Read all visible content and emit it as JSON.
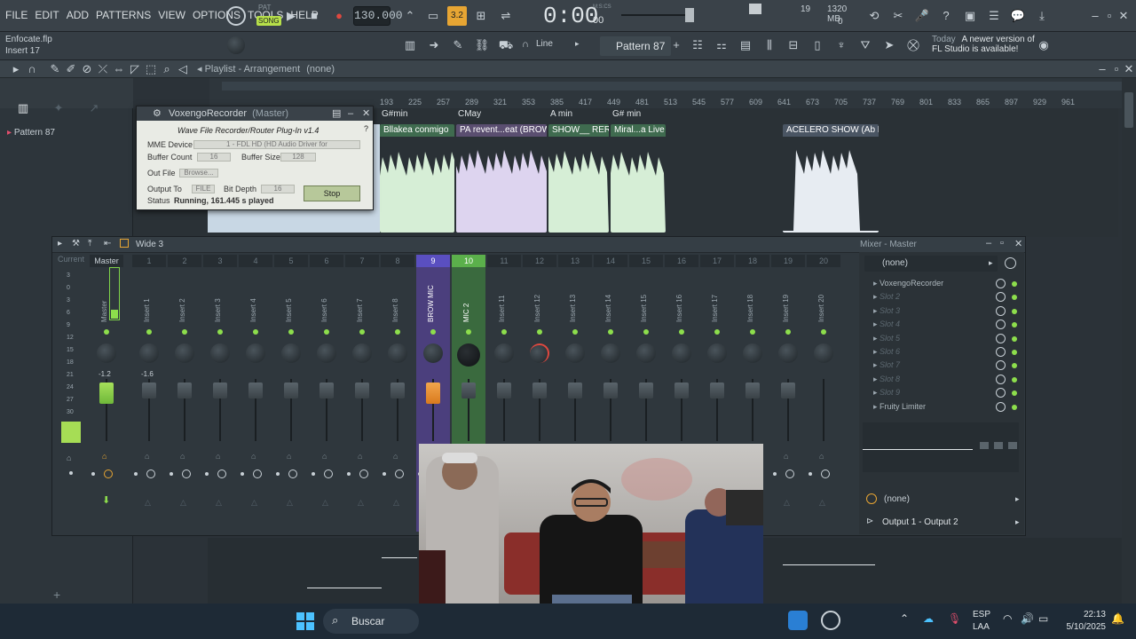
{
  "menu": [
    "FILE",
    "EDIT",
    "ADD",
    "PATTERNS",
    "VIEW",
    "OPTIONS",
    "TOOLS",
    "HELP"
  ],
  "transport": {
    "pat": "PAT",
    "song": "SONG",
    "tempo": "130.000",
    "time": "0:00",
    "time_suffix": "00",
    "time_unit": "M:S:CS",
    "beats": "3.2"
  },
  "cpu": {
    "value": "19",
    "memory": "1320 MB",
    "poly": "0"
  },
  "hint": {
    "file": "Enfocate.flp",
    "insert": "Insert 17"
  },
  "tools": {
    "snap": "Line",
    "pattern": "Pattern 87"
  },
  "news": {
    "label": "Today",
    "line1": "A newer version of",
    "line2": "FL Studio is available!"
  },
  "playlist": {
    "title": "Playlist - Arrangement",
    "sub": "(none)",
    "pattern_item": "Pattern 87"
  },
  "ruler": [
    "193",
    "225",
    "257",
    "289",
    "321",
    "353",
    "385",
    "417",
    "449",
    "481",
    "513",
    "545",
    "577",
    "609",
    "641",
    "673",
    "705",
    "737",
    "769",
    "801",
    "833",
    "865",
    "897",
    "929",
    "961"
  ],
  "markers": [
    {
      "label": "G#min"
    },
    {
      "label": "CMay"
    },
    {
      "label": "A min"
    },
    {
      "label": "G# min"
    }
  ],
  "clips": [
    {
      "label": "Bllakea conmigo",
      "color": "#3f6b4f"
    },
    {
      "label": "PA revent...eat (BROW)",
      "color": "#5a4e70"
    },
    {
      "label": "SHOW__ RERO",
      "color": "#3f6b4f"
    },
    {
      "label": "Miral...a Live",
      "color": "#3f6b4f"
    },
    {
      "label": "ACELERO SHOW (Ab Min)",
      "color": "#4a5563"
    }
  ],
  "plugin": {
    "title": "VoxengoRecorder",
    "title_suffix": "(Master)",
    "heading": "Wave File Recorder/Router Plug-In v1.4",
    "mme_label": "MME Device",
    "mme_value": "1 - FDL HD (HD Audio Driver for",
    "buffer_count_label": "Buffer Count",
    "buffer_count": "16",
    "buffer_size_label": "Buffer Size",
    "buffer_size": "128",
    "out_file_label": "Out File",
    "browse": "Browse...",
    "output_to_label": "Output To",
    "output_to": "FILE",
    "bit_depth_label": "Bit Depth",
    "bit_depth": "16",
    "stop": "Stop",
    "status_label": "Status",
    "status": "Running, 161.445 s played"
  },
  "mixer": {
    "title": "Wide 3",
    "right_title": "Mixer - Master",
    "current": "Current",
    "master": "Master",
    "master_level": "-1.2",
    "insert1_level": "-1.6",
    "numbers": [
      "1",
      "2",
      "3",
      "4",
      "5",
      "6",
      "7",
      "8",
      "9",
      "10",
      "11",
      "12",
      "13",
      "14",
      "15",
      "16",
      "17",
      "18",
      "19",
      "20"
    ],
    "strips": [
      "Master",
      "Insert 1",
      "Insert 2",
      "Insert 3",
      "Insert 4",
      "Insert 5",
      "Insert 6",
      "Insert 7",
      "Insert 8",
      "BROW MIC",
      "MIC 2",
      "Insert 11",
      "Insert 12",
      "Insert 13",
      "Insert 14",
      "Insert 15",
      "Insert 16",
      "Insert 17",
      "Insert 18",
      "Insert 19",
      "Insert 20"
    ],
    "meter_scale": [
      "3",
      "0",
      "3",
      "6",
      "9",
      "12",
      "15",
      "18",
      "21",
      "24",
      "27",
      "30"
    ],
    "preset": "(none)",
    "slots": [
      "VoxengoRecorder",
      "Slot 2",
      "Slot 3",
      "Slot 4",
      "Slot 5",
      "Slot 6",
      "Slot 7",
      "Slot 8",
      "Slot 9",
      "Fruity Limiter"
    ],
    "eq_preset": "(none)",
    "output": "Output 1 - Output 2"
  },
  "taskbar": {
    "search": "Buscar",
    "lang1": "ESP",
    "lang2": "LAA",
    "time": "22:13",
    "date": "5/10/2025"
  }
}
